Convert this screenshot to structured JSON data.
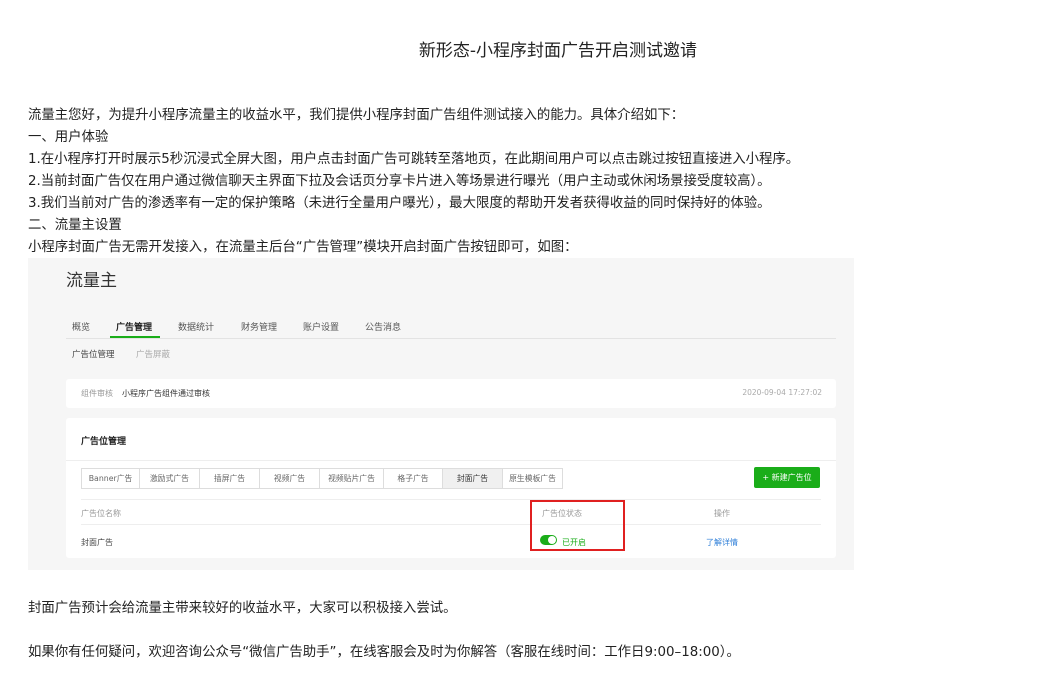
{
  "article": {
    "title": "新形态-小程序封面广告开启测试邀请",
    "paragraphs": [
      "流量主您好，为提升小程序流量主的收益水平，我们提供小程序封面广告组件测试接入的能力。具体介绍如下：",
      "一、用户体验",
      "1.在小程序打开时展示5秒沉浸式全屏大图，用户点击封面广告可跳转至落地页，在此期间用户可以点击跳过按钮直接进入小程序。",
      "2.当前封面广告仅在用户通过微信聊天主界面下拉及会话页分享卡片进入等场景进行曝光（用户主动或休闲场景接受度较高）。",
      "3.我们当前对广告的渗透率有一定的保护策略（未进行全量用户曝光），最大限度的帮助开发者获得收益的同时保持好的体验。",
      "二、流量主设置",
      "小程序封面广告无需开发接入，在流量主后台“广告管理”模块开启封面广告按钮即可，如图："
    ],
    "closing": [
      "封面广告预计会给流量主带来较好的收益水平，大家可以积极接入尝试。",
      "如果你有任何疑问，欢迎咨询公众号“微信广告助手”，在线客服会及时为你解答（客服在线时间：工作日9:00–18:00）。"
    ]
  },
  "screenshot": {
    "brand": "流量主",
    "nav": [
      "概览",
      "广告管理",
      "数据统计",
      "财务管理",
      "账户设置",
      "公告消息"
    ],
    "nav_active_index": 1,
    "subnav": [
      "广告位管理",
      "广告屏蔽"
    ],
    "review": {
      "label": "组件审核",
      "value": "小程序广告组件通过审核",
      "timestamp": "2020-09-04 17:27:02"
    },
    "panel_title": "广告位管理",
    "ad_tabs": [
      "Banner广告",
      "激励式广告",
      "插屏广告",
      "视频广告",
      "视频贴片广告",
      "格子广告",
      "封面广告",
      "原生模板广告"
    ],
    "ad_tab_selected_index": 6,
    "new_button": "+ 新建广告位",
    "table": {
      "headers": [
        "广告位名称",
        "广告位状态",
        "操作"
      ],
      "row": {
        "name": "封面广告",
        "status": "已开启",
        "action": "了解详情"
      }
    },
    "colors": {
      "accent": "#1aad19",
      "link": "#2f7fd8",
      "highlight": "#e02020"
    }
  }
}
